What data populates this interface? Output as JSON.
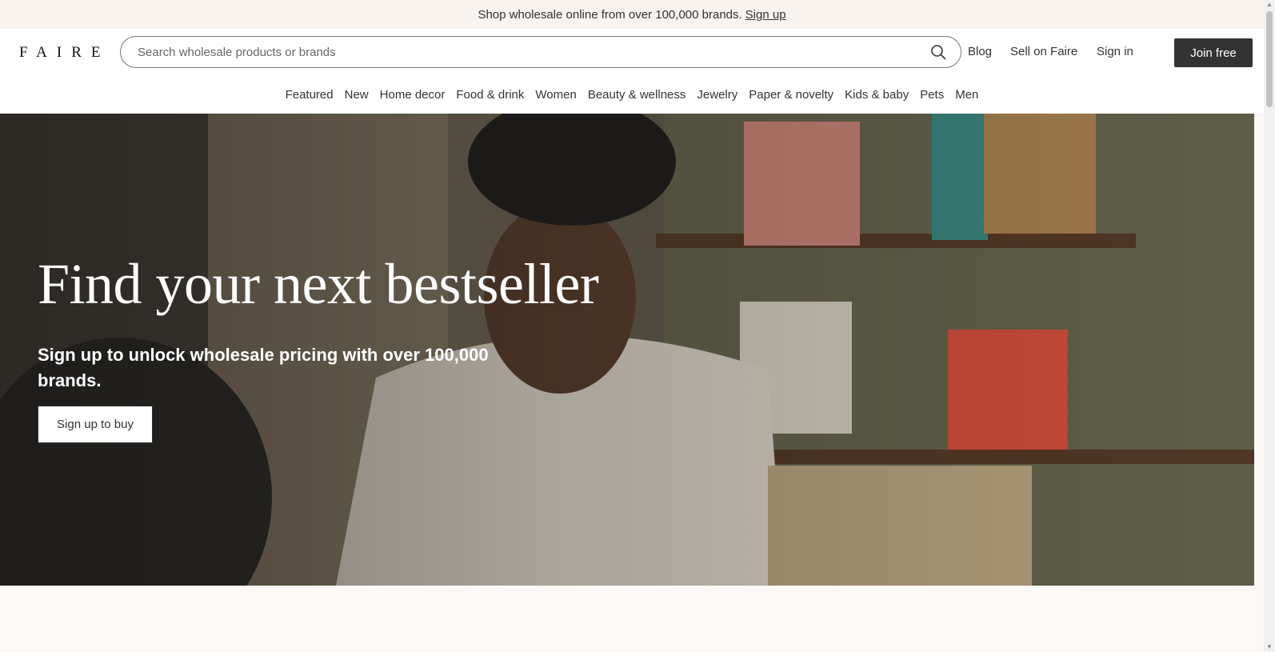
{
  "banner": {
    "text": "Shop wholesale online from over 100,000 brands.",
    "link": "Sign up"
  },
  "header": {
    "logo": "FAIRE",
    "search_placeholder": "Search wholesale products or brands",
    "links": {
      "blog": "Blog",
      "sell": "Sell on Faire",
      "signin": "Sign in"
    },
    "join": "Join free"
  },
  "categories": [
    "Featured",
    "New",
    "Home decor",
    "Food & drink",
    "Women",
    "Beauty & wellness",
    "Jewelry",
    "Paper & novelty",
    "Kids & baby",
    "Pets",
    "Men"
  ],
  "hero": {
    "title": "Find your next bestseller",
    "subtitle": "Sign up to unlock wholesale pricing with over 100,000 brands.",
    "button": "Sign up to buy"
  },
  "colors": {
    "join_bg": "#333333",
    "banner_bg": "#f8f3ef",
    "page_bg": "#fbf8f5"
  }
}
